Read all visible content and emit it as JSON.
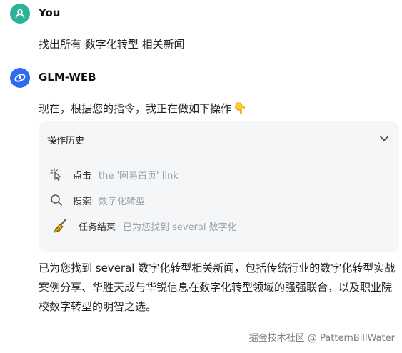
{
  "user": {
    "name": "You",
    "message": "找出所有 数字化转型 相关新闻"
  },
  "assistant": {
    "name": "GLM-WEB",
    "intro": "现在，根据您的指令，我正在做如下操作",
    "intro_emoji": "👇",
    "history": {
      "title": "操作历史",
      "items": [
        {
          "icon": "click-cursor-icon",
          "action": "点击",
          "detail": "the '网易首页' link"
        },
        {
          "icon": "search-icon",
          "action": "搜索",
          "detail": "数字化转型"
        },
        {
          "icon": "broom-icon",
          "action": "任务结束",
          "detail": "已为您找到 several 数字化"
        }
      ]
    },
    "answer": "已为您找到 several 数字化转型相关新闻，包括传统行业的数字化转型实战案例分享、华胜天成与华锐信息在数字化转型领域的强强联合，以及职业院校数字转型的明智之选。"
  },
  "watermark": "掘金技术社区 @ PatternBillWater",
  "colors": {
    "user_avatar": "#2bb39a",
    "bot_avatar": "#2f6bf0",
    "panel_bg": "#f5f6f7",
    "detail_text": "#9aa0a6"
  }
}
